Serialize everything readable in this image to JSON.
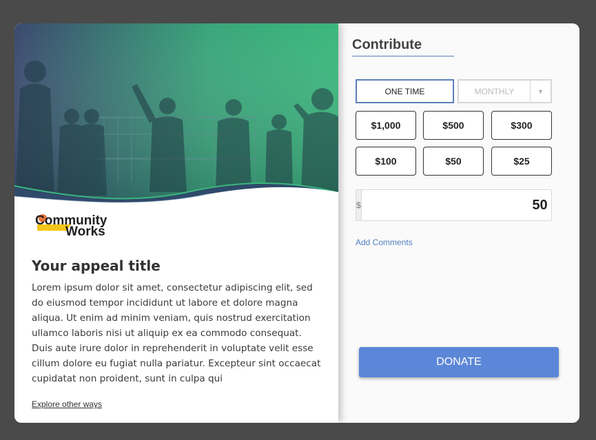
{
  "left": {
    "logo_text_line1": "Community",
    "logo_text_line2": "Works",
    "appeal_title": "Your appeal title",
    "appeal_body": "Lorem ipsum dolor sit amet, consectetur adipiscing elit, sed do eiusmod tempor incididunt ut labore et dolore magna aliqua. Ut enim ad minim veniam, quis nostrud exercitation ullamco laboris nisi ut aliquip ex ea commodo consequat. Duis aute irure dolor in reprehenderit in voluptate velit esse cillum dolore eu fugiat nulla pariatur. Excepteur sint occaecat cupidatat non proident, sunt in culpa qui",
    "explore_link": "Explore other ways"
  },
  "right": {
    "title": "Contribute",
    "frequency": {
      "one_time": "ONE TIME",
      "monthly": "MONTHLY",
      "selected": "ONE TIME"
    },
    "amounts": [
      "$1,000",
      "$500",
      "$300",
      "$100",
      "$50",
      "$25"
    ],
    "currency_symbol": "$",
    "amount_value": "50",
    "add_comments": "Add Comments",
    "donate_label": "DONATE"
  },
  "colors": {
    "accent_blue": "#5a7fb8",
    "donate_button": "#5c87d8",
    "hero_gradient_start": "#3a4a6e",
    "hero_gradient_end": "#3bb77c",
    "logo_yellow": "#f5c518",
    "logo_orange": "#e8743b"
  },
  "icons": {
    "dropdown": "caret-down-icon"
  }
}
